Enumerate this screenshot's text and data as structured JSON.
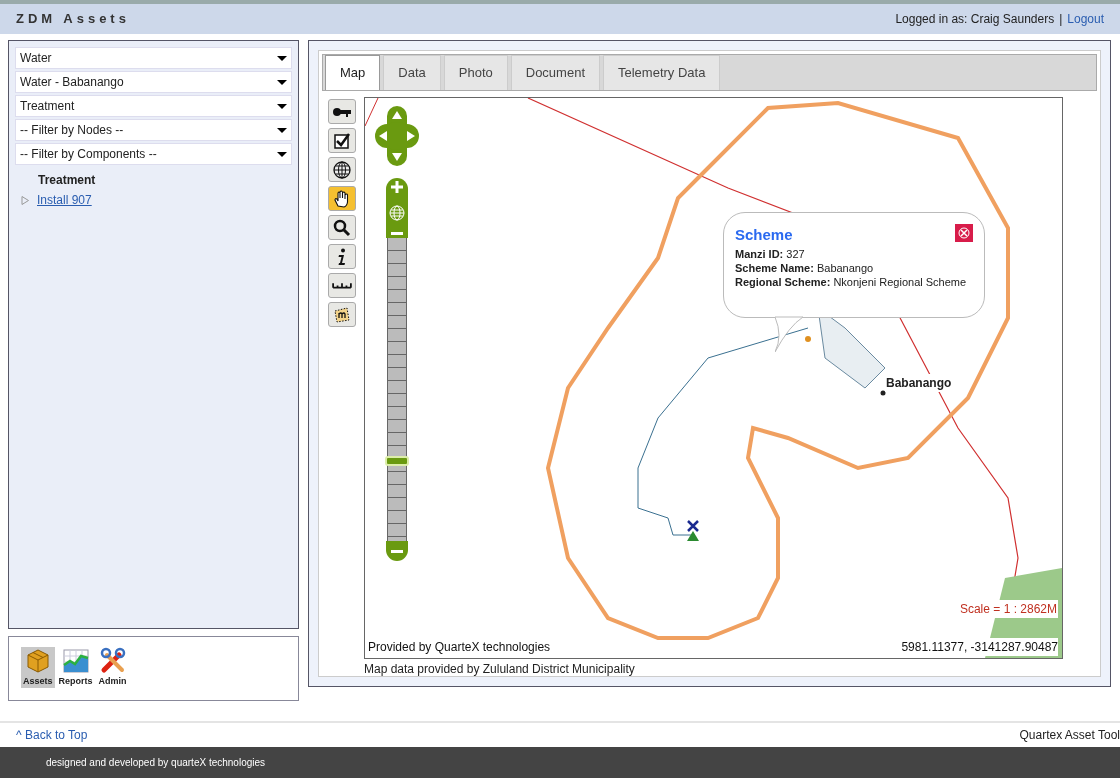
{
  "header": {
    "title": "ZDM Assets",
    "login_text": "Logged in as: Craig Saunders",
    "separator": "|",
    "logout_link": "Logout"
  },
  "filters": [
    {
      "value": "Water"
    },
    {
      "value": "Water - Babanango"
    },
    {
      "value": "Treatment"
    },
    {
      "value": "-- Filter by Nodes --"
    },
    {
      "value": "-- Filter by Components --"
    }
  ],
  "tree": {
    "heading": "Treatment",
    "items": [
      {
        "label": "Install 907",
        "expanded": false
      }
    ]
  },
  "modules": [
    {
      "label": "Assets",
      "kind": "assets",
      "selected": true
    },
    {
      "label": "Reports",
      "kind": "reports",
      "selected": false
    },
    {
      "label": "Admin",
      "kind": "admin",
      "selected": false
    }
  ],
  "tabs": [
    {
      "label": "Map",
      "selected": true
    },
    {
      "label": "Data",
      "selected": false
    },
    {
      "label": "Photo",
      "selected": false
    },
    {
      "label": "Document",
      "selected": false
    },
    {
      "label": "Telemetry Data",
      "selected": false
    }
  ],
  "map_tools": [
    {
      "kind": "key",
      "selected": false
    },
    {
      "kind": "check",
      "selected": false
    },
    {
      "kind": "globe",
      "selected": false
    },
    {
      "kind": "hand",
      "selected": true
    },
    {
      "kind": "zoom",
      "selected": false
    },
    {
      "kind": "info",
      "selected": false
    },
    {
      "kind": "ruler",
      "selected": false
    },
    {
      "kind": "measure",
      "selected": false
    }
  ],
  "map": {
    "zoom_slider": {
      "level": 0.26
    },
    "popup": {
      "title": "Scheme",
      "lines": [
        "**Manzi ID:** 327",
        "**Scheme Name:** Babanango",
        "**Regional Scheme:** Nkonjeni Regional Scheme"
      ]
    },
    "place_label": "Babanango",
    "scale": "Scale = 1 : 2862M",
    "attribution": "Provided by QuarteX technologies",
    "coordinates": "5981.11377, -3141287.90487"
  },
  "map_credit": "Map data provided by Zululand District Municipality",
  "footer": {
    "back_to_top": "^ Back to Top",
    "app_name": "Quartex Asset Tool",
    "credit": "designed and developed by quarteX technologies"
  }
}
